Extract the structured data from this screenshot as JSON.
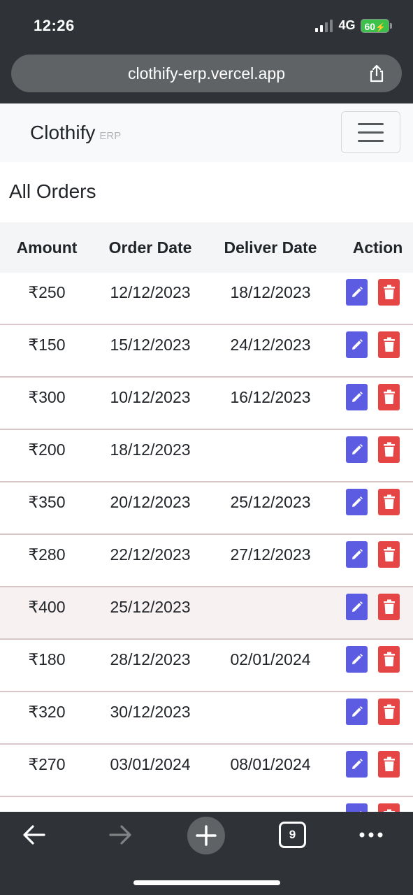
{
  "status_bar": {
    "time": "12:26",
    "network": "4G",
    "battery": "60"
  },
  "browser": {
    "url": "clothify-erp.vercel.app",
    "tab_count": "9"
  },
  "navbar": {
    "brand": "Clothify",
    "brand_sub": "ERP"
  },
  "page": {
    "title": "All Orders"
  },
  "table": {
    "headers": [
      "Amount",
      "Order Date",
      "Deliver Date",
      "Action"
    ],
    "rows": [
      {
        "amount": "₹250",
        "order_date": "12/12/2023",
        "deliver_date": "18/12/2023"
      },
      {
        "amount": "₹150",
        "order_date": "15/12/2023",
        "deliver_date": "24/12/2023"
      },
      {
        "amount": "₹300",
        "order_date": "10/12/2023",
        "deliver_date": "16/12/2023"
      },
      {
        "amount": "₹200",
        "order_date": "18/12/2023",
        "deliver_date": ""
      },
      {
        "amount": "₹350",
        "order_date": "20/12/2023",
        "deliver_date": "25/12/2023"
      },
      {
        "amount": "₹280",
        "order_date": "22/12/2023",
        "deliver_date": "27/12/2023"
      },
      {
        "amount": "₹400",
        "order_date": "25/12/2023",
        "deliver_date": ""
      },
      {
        "amount": "₹180",
        "order_date": "28/12/2023",
        "deliver_date": "02/01/2024"
      },
      {
        "amount": "₹320",
        "order_date": "30/12/2023",
        "deliver_date": ""
      },
      {
        "amount": "₹270",
        "order_date": "03/01/2024",
        "deliver_date": "08/01/2024"
      },
      {
        "amount": "",
        "order_date": "",
        "deliver_date": ""
      }
    ]
  },
  "icons": {
    "edit": "pencil-icon",
    "delete": "trash-icon",
    "share": "share-icon",
    "back": "back-arrow-icon",
    "forward": "forward-arrow-icon",
    "new_tab": "plus-icon",
    "more": "more-icon"
  },
  "colors": {
    "edit_button": "#5b5ce2",
    "delete_button": "#e64545",
    "browser_chrome": "#2f3337",
    "battery": "#3cc24a"
  }
}
